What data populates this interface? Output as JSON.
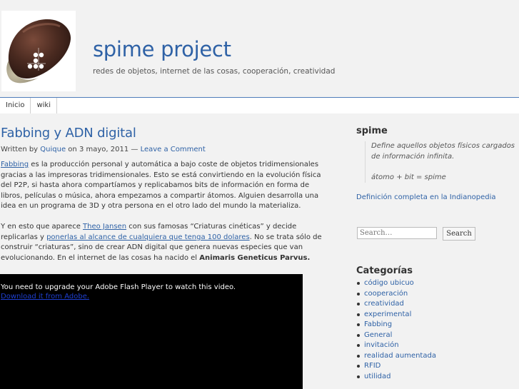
{
  "site": {
    "title": "spime project",
    "description": "redes de objetos, internet de las cosas, cooperación, creatividad"
  },
  "nav": [
    "Inicio",
    "wiki"
  ],
  "post": {
    "title": "Fabbing y ADN digital",
    "meta_written_by": "Written by ",
    "meta_author": "Quique",
    "meta_on": " on 3 mayo, 2011 — ",
    "meta_comment": "Leave a Comment",
    "p1_link": "Fabbing",
    "p1_text": " es la producción personal y automática a bajo coste de objetos tridimensionales gracias a las impresoras tridimensionales. Esto se está convirtiendo en la evolución física del P2P, si hasta ahora compartíamos y replicabamos bits de información en forma de libros, películas o música, ahora empezamos a compartir átomos. Alguien desarrolla una idea en un programa de 3D y otra persona en el otro lado del mundo la materializa.",
    "p2_a": "Y en esto que aparece ",
    "p2_link1": "Theo Jansen",
    "p2_b": " con sus famosas “Criaturas cinéticas” y decide replicarlas y ",
    "p2_link2": "ponerlas al alcance de cualquiera que tenga 100 dolares",
    "p2_c": ". No se trata sólo de construir “criaturas”, sino de crear ADN digital que genera nuevas especies que van evolucionando. En el internet de las cosas ha nacido el ",
    "p2_bold": "Animaris Geneticus Parvus.",
    "video_message": "You need to upgrade your Adobe Flash Player to watch this video.",
    "video_link": "Download it from Adobe."
  },
  "sidebar": {
    "spime_title": "spime",
    "quote_line1": "Define aquellos objetos físicos cargados de información infinita.",
    "quote_line2": "átomo + bit = spime",
    "definition_link": "Definición completa en la Indianopedia",
    "search_placeholder": "Search…",
    "search_button": "Search",
    "categories_title": "Categorías",
    "categories": [
      "código ubicuo",
      "cooperación",
      "creatividad",
      "experimental",
      "Fabbing",
      "General",
      "invitación",
      "realidad aumentada",
      "RFID",
      "utilidad"
    ]
  },
  "colors": {
    "link": "#2f62a6",
    "background": "#f2f2f2",
    "video_bg": "#000000"
  },
  "icons": [
    "chestnut-logo"
  ]
}
